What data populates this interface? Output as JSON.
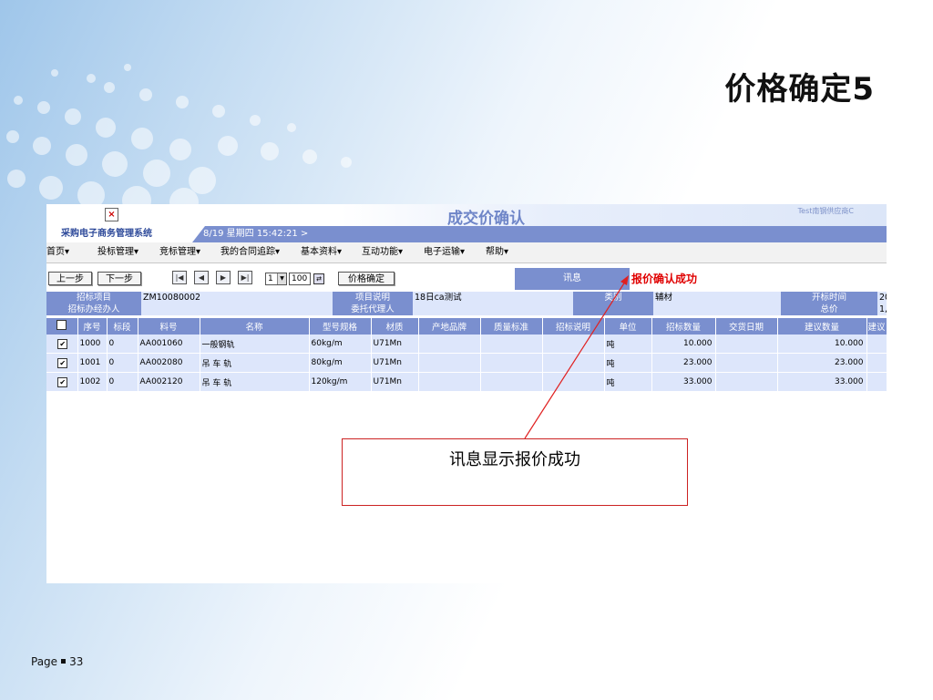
{
  "slide": {
    "title": "价格确定5",
    "page_label": "Page",
    "page_number": "33"
  },
  "window": {
    "title": "成交价确认",
    "user_info": "Test南钢供应商C",
    "close_icon": "×"
  },
  "app_bar": {
    "system_name": "采购电子商务管理系统",
    "datetime": "8/19 星期四  15:42:21 >"
  },
  "menu": [
    "首页▾",
    "投标管理▾",
    "竞标管理▾",
    "我的合同追踪▾",
    "基本资料▾",
    "互动功能▾",
    "电子运输▾",
    "帮助▾"
  ],
  "toolbar": {
    "prev": "上一步",
    "next": "下一步",
    "page_current": "1",
    "page_total": "100",
    "confirm": "价格确定"
  },
  "message": {
    "label": "讯息",
    "text": "报价确认成功"
  },
  "info": {
    "project_label": "招标项目",
    "project_value": "ZM10080002",
    "desc_label": "项目说明",
    "desc_value": "18日ca测试",
    "category_label": "类别",
    "category_value": "辅材",
    "open_label": "开标时间",
    "open_value": "20",
    "handler_label": "招标办经办人",
    "handler_value": "",
    "agent_label": "委托代理人",
    "agent_value": "",
    "total_label": "总价",
    "total_value": "1,"
  },
  "table": {
    "headers": [
      "序号",
      "标段",
      "料号",
      "名称",
      "型号规格",
      "材质",
      "产地品牌",
      "质量标准",
      "招标说明",
      "单位",
      "招标数量",
      "交货日期",
      "建议数量",
      "建议"
    ],
    "rows": [
      {
        "checked": "✔",
        "seq": "1000",
        "section": "0",
        "part_no": "AA001060",
        "name": "一般钢轨",
        "spec": "60kg/m",
        "material": "U71Mn",
        "origin": "",
        "quality": "",
        "note": "",
        "unit": "吨",
        "qty": "10.000",
        "delivery": "",
        "suggest_qty": "10.000",
        "suggest": ""
      },
      {
        "checked": "✔",
        "seq": "1001",
        "section": "0",
        "part_no": "AA002080",
        "name": "吊 车 轨",
        "spec": "80kg/m",
        "material": "U71Mn",
        "origin": "",
        "quality": "",
        "note": "",
        "unit": "吨",
        "qty": "23.000",
        "delivery": "",
        "suggest_qty": "23.000",
        "suggest": ""
      },
      {
        "checked": "✔",
        "seq": "1002",
        "section": "0",
        "part_no": "AA002120",
        "name": "吊 车 轨",
        "spec": "120kg/m",
        "material": "U71Mn",
        "origin": "",
        "quality": "",
        "note": "",
        "unit": "吨",
        "qty": "33.000",
        "delivery": "",
        "suggest_qty": "33.000",
        "suggest": ""
      }
    ]
  },
  "callout": {
    "text": "讯息显示报价成功"
  },
  "colors": {
    "accent": "#7a8fcf",
    "message": "#e00000",
    "callout_border": "#cc2222"
  }
}
